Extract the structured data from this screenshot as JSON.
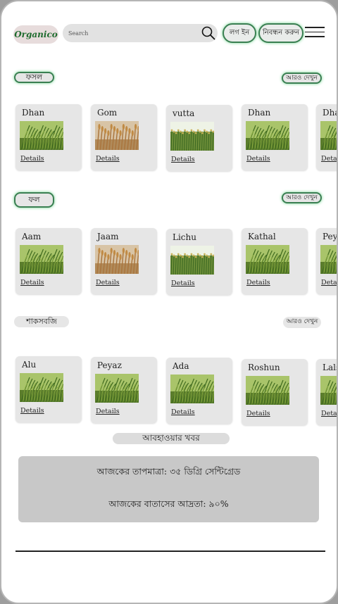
{
  "header": {
    "logo": "Organico",
    "search_placeholder": "Search",
    "login_label": "লগ ইন",
    "register_label": "নিবন্ধন করুন"
  },
  "sections": [
    {
      "title": "ফসল",
      "more_label": "আরও দেখুন",
      "items": [
        {
          "name": "Dhan",
          "image": "green-paddy",
          "details": "Details"
        },
        {
          "name": "Gom",
          "image": "wheat",
          "details": "Details"
        },
        {
          "name": "vutta",
          "image": "corn-field",
          "details": "Details"
        },
        {
          "name": "Dhan",
          "image": "green-paddy",
          "details": "Details"
        },
        {
          "name": "Dhan",
          "image": "green-paddy",
          "details": "Details"
        }
      ]
    },
    {
      "title": "ফল",
      "more_label": "আরও দেখুন",
      "items": [
        {
          "name": "Aam",
          "image": "green-paddy",
          "details": "Details"
        },
        {
          "name": "Jaam",
          "image": "wheat",
          "details": "Details"
        },
        {
          "name": "Lichu",
          "image": "corn-field",
          "details": "Details"
        },
        {
          "name": "Kathal",
          "image": "green-paddy",
          "details": "Details"
        },
        {
          "name": "Peyara",
          "image": "green-paddy",
          "details": "Details"
        }
      ]
    },
    {
      "title": "শাকসবজি",
      "more_label": "আরও দেখুন",
      "items": [
        {
          "name": "Alu",
          "image": "green-paddy",
          "details": "Details"
        },
        {
          "name": "Peyaz",
          "image": "green-paddy",
          "details": "Details"
        },
        {
          "name": "Ada",
          "image": "green-paddy",
          "details": "Details"
        },
        {
          "name": "Roshun",
          "image": "green-paddy",
          "details": "Details"
        },
        {
          "name": "Lalshak",
          "image": "green-paddy",
          "details": "Details"
        }
      ]
    }
  ],
  "weather": {
    "title": "আবহাওয়ার খবর",
    "temperature": "আজকের তাপমাত্রা: ৩৫ ডিগ্রি সেন্টিগ্রেড",
    "humidity": "আজকের বাতাসের আদ্রতা: ৯০%"
  },
  "colors": {
    "accent_green": "#3a7f52",
    "glow": "#6fd28c",
    "card_bg": "#e6e6e6",
    "weather_bg": "#c8c8c8"
  }
}
